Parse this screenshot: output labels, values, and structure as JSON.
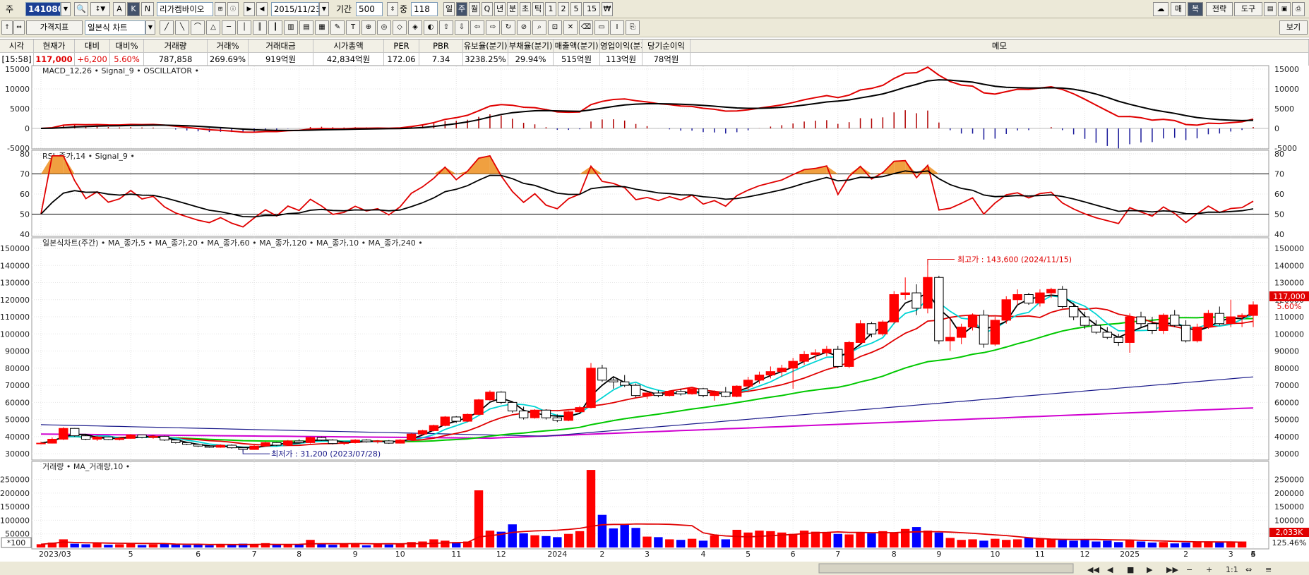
{
  "toolbar": {
    "type_label": "주",
    "code": "141080",
    "name": "리가켐바이오",
    "date": "2015/11/23",
    "period_label": "기간",
    "period_value": "500",
    "count_label": "중",
    "count_value": "118",
    "periods": [
      "일",
      "주",
      "월",
      "Q",
      "년",
      "분",
      "초",
      "틱",
      "1",
      "2",
      "5",
      "15",
      "₩"
    ],
    "active_period": "주",
    "btn_a": "A",
    "btn_k": "K",
    "btn_n": "N",
    "right_buttons": [
      "매",
      "복",
      "전략",
      "도구"
    ],
    "indicator_label": "가격지표",
    "chart_type": "일본식 차트",
    "view_label": "보기"
  },
  "quote": {
    "headers": [
      "시각",
      "현재가",
      "대비",
      "대비%",
      "거래량",
      "거래%",
      "거래대금",
      "시가총액",
      "PER",
      "PBR",
      "유보율(분기)",
      "부채율(분기)",
      "매출액(분기)",
      "영업이익(분기)",
      "당기순이익",
      "메모"
    ],
    "values": [
      "[15:58]",
      "117,000",
      "+6,200",
      "5.60%",
      "787,858",
      "269.69%",
      "919억원",
      "42,834억원",
      "172.06",
      "7.34",
      "3238.25%",
      "29.94%",
      "515억원",
      "113억원",
      "78억원",
      ""
    ]
  },
  "macd": {
    "title": "MACD_12,26 • Signal_9 • OSCILLATOR •",
    "ticks": [
      "15000",
      "10000",
      "5000",
      "0",
      "-5000"
    ]
  },
  "rsi": {
    "title": "RSI_종가,14 • Signal_9 •",
    "ticks": [
      "80",
      "70",
      "60",
      "50",
      "40"
    ]
  },
  "price": {
    "title": "일본식차트(주간) • MA_종가,5 • MA_종가,20 • MA_종가,60 • MA_종가,120 • MA_종가,10 • MA_종가,240 •",
    "ticks": [
      "150000",
      "140000",
      "130000",
      "120000",
      "110000",
      "100000",
      "90000",
      "80000",
      "70000",
      "60000",
      "50000",
      "40000",
      "30000"
    ],
    "high_label": "최고가 : 143,600 (2024/11/15)",
    "low_label": "최저가 : 31,200 (2023/07/28)",
    "current_label": "117,000",
    "change_label": "5.60%"
  },
  "volume": {
    "title": "거래량 • MA_거래량,10 •",
    "ticks": [
      "250000",
      "200000",
      "150000",
      "100000",
      "50000"
    ],
    "unit_label": "*100",
    "current_label": "2,033K",
    "pct_label": "125.46%"
  },
  "x_labels": [
    "2023/03",
    "5",
    "6",
    "7",
    "8",
    "9",
    "10",
    "11",
    "12",
    "2024",
    "2",
    "3",
    "4",
    "5",
    "6",
    "7",
    "8",
    "9",
    "10",
    "11",
    "12",
    "2025",
    "2",
    "3",
    "4",
    "5",
    "6"
  ],
  "colors": {
    "up": "#ff0000",
    "down": "#0000ff",
    "ma5": "#e00000",
    "ma20": "#000000",
    "ma60": "#00c800",
    "ma120": "#1a1a8a",
    "ma10": "#00d4d4",
    "ma240": "#d000d0"
  },
  "chart_data": {
    "type": "candlestick",
    "interval": "weekly",
    "price_ylim": [
      28000,
      150000
    ],
    "candles": [
      [
        36000,
        37000,
        35500,
        36200
      ],
      [
        36200,
        39500,
        36000,
        38500
      ],
      [
        38500,
        45500,
        38000,
        44800
      ],
      [
        44800,
        45000,
        40000,
        40500
      ],
      [
        40500,
        41000,
        38000,
        38500
      ],
      [
        38500,
        40500,
        37500,
        39800
      ],
      [
        39800,
        40000,
        38000,
        38300
      ],
      [
        38300,
        39500,
        37800,
        39000
      ],
      [
        39000,
        41500,
        38800,
        41000
      ],
      [
        41000,
        41200,
        39000,
        39500
      ],
      [
        39500,
        41000,
        38800,
        40200
      ],
      [
        40200,
        40500,
        37500,
        38000
      ],
      [
        38000,
        38500,
        36000,
        36500
      ],
      [
        36500,
        37000,
        35000,
        35500
      ],
      [
        35500,
        36000,
        34000,
        34500
      ],
      [
        34500,
        35000,
        33500,
        33800
      ],
      [
        33800,
        35500,
        33500,
        35000
      ],
      [
        35000,
        35500,
        33000,
        33500
      ],
      [
        33500,
        33800,
        31200,
        32500
      ],
      [
        32500,
        35000,
        32300,
        34500
      ],
      [
        34500,
        37000,
        34000,
        36500
      ],
      [
        36500,
        36800,
        34500,
        35000
      ],
      [
        35000,
        38000,
        34800,
        37500
      ],
      [
        37500,
        38500,
        36000,
        36500
      ],
      [
        36500,
        40000,
        36000,
        39500
      ],
      [
        39500,
        40000,
        37500,
        38000
      ],
      [
        38000,
        38500,
        35500,
        36000
      ],
      [
        36000,
        37000,
        35000,
        36500
      ],
      [
        36500,
        38500,
        36000,
        38000
      ],
      [
        38000,
        38500,
        36500,
        37000
      ],
      [
        37000,
        38000,
        36000,
        37500
      ],
      [
        37500,
        38000,
        35800,
        36200
      ],
      [
        36200,
        38500,
        36000,
        38000
      ],
      [
        38000,
        42000,
        37800,
        41500
      ],
      [
        41500,
        44000,
        41000,
        43500
      ],
      [
        43500,
        47000,
        43000,
        46500
      ],
      [
        46500,
        52000,
        46000,
        51500
      ],
      [
        51500,
        52000,
        48000,
        49000
      ],
      [
        49000,
        53500,
        48500,
        53000
      ],
      [
        53000,
        62000,
        52500,
        61500
      ],
      [
        61500,
        67000,
        61000,
        66000
      ],
      [
        66000,
        66500,
        59000,
        60000
      ],
      [
        60000,
        60500,
        54000,
        55000
      ],
      [
        55000,
        57500,
        50000,
        51000
      ],
      [
        51000,
        56000,
        50500,
        55500
      ],
      [
        55500,
        56000,
        50000,
        51000
      ],
      [
        51000,
        53000,
        48500,
        49500
      ],
      [
        49500,
        55000,
        49000,
        54500
      ],
      [
        54500,
        58000,
        54000,
        57000
      ],
      [
        57000,
        83000,
        56500,
        80000
      ],
      [
        80000,
        82000,
        72000,
        73000
      ],
      [
        73000,
        75000,
        68000,
        72000
      ],
      [
        72000,
        76000,
        69000,
        70000
      ],
      [
        70000,
        71000,
        63000,
        64000
      ],
      [
        64000,
        66000,
        62000,
        65500
      ],
      [
        65500,
        67000,
        63000,
        64000
      ],
      [
        64000,
        67000,
        63500,
        66500
      ],
      [
        66500,
        68000,
        64000,
        65000
      ],
      [
        65000,
        69000,
        64500,
        68000
      ],
      [
        68000,
        68500,
        63000,
        64000
      ],
      [
        64000,
        67000,
        61000,
        66000
      ],
      [
        66000,
        69000,
        63000,
        63500
      ],
      [
        63500,
        70000,
        63000,
        69500
      ],
      [
        69500,
        75000,
        67000,
        73000
      ],
      [
        73000,
        78000,
        71000,
        76000
      ],
      [
        76000,
        81000,
        74000,
        78000
      ],
      [
        78000,
        82000,
        75000,
        80000
      ],
      [
        80000,
        86000,
        68000,
        84000
      ],
      [
        84000,
        90000,
        82000,
        88000
      ],
      [
        88000,
        91000,
        85000,
        89000
      ],
      [
        89000,
        93000,
        87000,
        91000
      ],
      [
        91000,
        93000,
        80000,
        81000
      ],
      [
        81000,
        96000,
        80000,
        95000
      ],
      [
        95000,
        108000,
        94000,
        106000
      ],
      [
        106000,
        107000,
        98000,
        100000
      ],
      [
        100000,
        108000,
        99000,
        107000
      ],
      [
        107000,
        125000,
        106000,
        123000
      ],
      [
        123000,
        133000,
        120000,
        124000
      ],
      [
        124000,
        129000,
        111000,
        115000
      ],
      [
        115000,
        143600,
        112000,
        133000
      ],
      [
        133000,
        134000,
        94000,
        96000
      ],
      [
        96000,
        110000,
        90000,
        98000
      ],
      [
        98000,
        106000,
        94000,
        104000
      ],
      [
        104000,
        112000,
        102000,
        111000
      ],
      [
        111000,
        114000,
        92000,
        94000
      ],
      [
        94000,
        110000,
        93000,
        108000
      ],
      [
        108000,
        122000,
        106000,
        120000
      ],
      [
        120000,
        126000,
        117000,
        123000
      ],
      [
        123000,
        124000,
        117000,
        118000
      ],
      [
        118000,
        126000,
        116000,
        124000
      ],
      [
        124000,
        127000,
        121000,
        126000
      ],
      [
        126000,
        128000,
        115000,
        116000
      ],
      [
        116000,
        118000,
        108000,
        110000
      ],
      [
        110000,
        113000,
        103000,
        105000
      ],
      [
        105000,
        108000,
        100000,
        101000
      ],
      [
        101000,
        104000,
        97000,
        98000
      ],
      [
        98000,
        100000,
        93000,
        95000
      ],
      [
        95000,
        112000,
        89000,
        110000
      ],
      [
        110000,
        113000,
        104000,
        106000
      ],
      [
        106000,
        110000,
        100000,
        102000
      ],
      [
        102000,
        112000,
        100000,
        111000
      ],
      [
        111000,
        114000,
        104000,
        105000
      ],
      [
        105000,
        108000,
        95000,
        96000
      ],
      [
        96000,
        106000,
        95000,
        104000
      ],
      [
        104000,
        114000,
        103000,
        112000
      ],
      [
        112000,
        116000,
        105000,
        106000
      ],
      [
        106000,
        120000,
        104000,
        110000
      ],
      [
        110000,
        112000,
        104000,
        110800
      ],
      [
        110800,
        119000,
        104000,
        117000
      ]
    ],
    "volume_ylim": [
      0,
      280000
    ],
    "volumes": [
      12000,
      18000,
      30000,
      14000,
      12000,
      16000,
      10000,
      12000,
      14000,
      9000,
      12000,
      15000,
      11000,
      9000,
      10000,
      8000,
      12000,
      9000,
      14000,
      12000,
      16000,
      10000,
      13000,
      12000,
      28000,
      14000,
      10000,
      12000,
      16000,
      8000,
      13000,
      11000,
      12000,
      20000,
      22000,
      30000,
      25000,
      20000,
      22000,
      210000,
      62000,
      58000,
      85000,
      52000,
      45000,
      42000,
      38000,
      50000,
      60000,
      285000,
      120000,
      70000,
      85000,
      72000,
      40000,
      38000,
      30000,
      28000,
      32000,
      25000,
      45000,
      30000,
      65000,
      55000,
      62000,
      60000,
      55000,
      50000,
      62000,
      58000,
      55000,
      50000,
      48000,
      55000,
      52000,
      60000,
      55000,
      68000,
      75000,
      62000,
      55000,
      35000,
      28000,
      30000,
      25000,
      32000,
      28000,
      30000,
      35000,
      32000,
      30000,
      28000,
      25000,
      30000,
      22000,
      25000,
      20000,
      28000,
      22000,
      18000,
      20000,
      15000,
      18000,
      20000,
      22000,
      18000,
      20000,
      22000
    ],
    "macd_ylim": [
      -5000,
      15000
    ],
    "rsi_ylim": [
      40,
      80
    ]
  }
}
